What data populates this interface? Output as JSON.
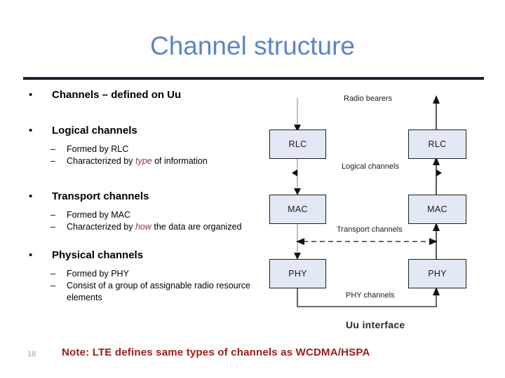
{
  "slide": {
    "title": "Channel structure",
    "page_number": "18",
    "footer_note": "Note: LTE defines same types of channels as WCDMA/HSPA",
    "title_color": "#5b86c4",
    "rule_color": "#19212e",
    "note_color": "#9b1b1b"
  },
  "bullets": [
    {
      "marker": "•",
      "text": "Channels – defined on Uu",
      "sub": []
    },
    {
      "marker": "•",
      "text": "Logical channels",
      "sub": [
        {
          "marker": "–",
          "before": "Formed by RLC",
          "em": "",
          "after": ""
        },
        {
          "marker": "–",
          "before": "Characterized by ",
          "em": "type",
          "after": " of information"
        }
      ]
    },
    {
      "marker": "•",
      "text": "Transport channels",
      "sub": [
        {
          "marker": "–",
          "before": "Formed by MAC",
          "em": "",
          "after": ""
        },
        {
          "marker": "–",
          "before": "Characterized by ",
          "em": "how",
          "after": " the data are organized"
        }
      ]
    },
    {
      "marker": "•",
      "text": "Physical channels",
      "sub": [
        {
          "marker": "–",
          "before": "Formed by PHY",
          "em": "",
          "after": ""
        },
        {
          "marker": "–",
          "before": "Consist of a group of assignable radio resource elements",
          "em": "",
          "after": ""
        }
      ]
    }
  ],
  "diagram": {
    "box_fill": "#e2e9f5",
    "box_border": "#1d1d1d",
    "nodes": {
      "left_rlc": "RLC",
      "right_rlc": "RLC",
      "left_mac": "MAC",
      "right_mac": "MAC",
      "left_phy": "PHY",
      "right_phy": "PHY"
    },
    "labels": {
      "radio_bearers": "Radio bearers",
      "logical_channels": "Logical channels",
      "transport_channels": "Transport channels",
      "phy_channels": "PHY channels",
      "uu_interface": "Uu interface"
    }
  }
}
